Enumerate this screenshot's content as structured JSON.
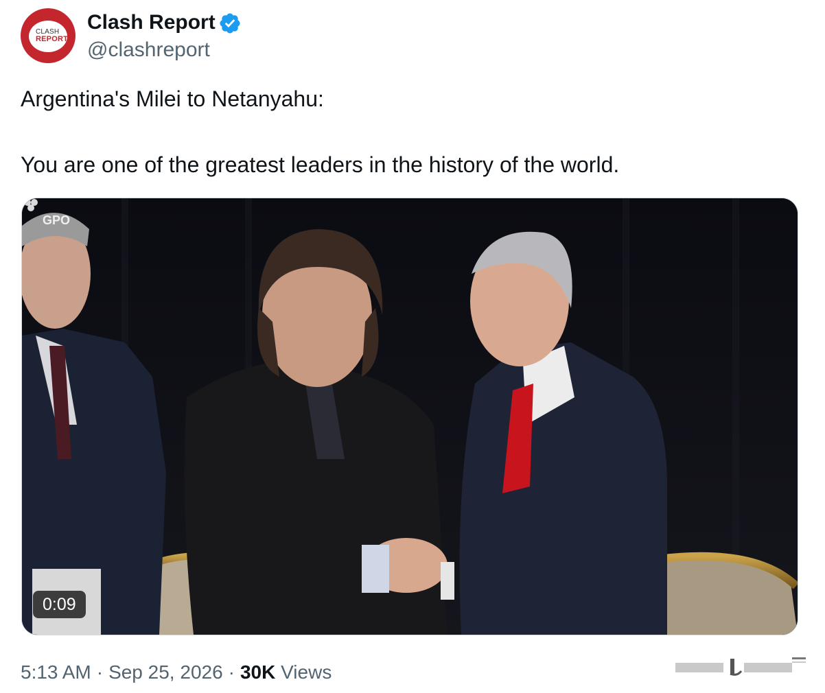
{
  "account": {
    "display_name": "Clash Report",
    "handle": "@clashreport",
    "verified": true,
    "avatar": {
      "line1": "CLASH",
      "line2": "REPORT",
      "color": "#c4262e"
    }
  },
  "tweet": {
    "lines": [
      "Argentina's Milei to Netanyahu:",
      "You are one of the greatest leaders in the history of the world."
    ]
  },
  "media": {
    "type": "video",
    "icon": "video-thumbnail",
    "watermark": "GPO",
    "duration": "0:09"
  },
  "meta": {
    "time": "5:13 AM",
    "date": "Sep 25, 2026",
    "separator": "·",
    "views_count": "30K",
    "views_label": "Views"
  },
  "colors": {
    "text_primary": "#0f1419",
    "text_secondary": "#536471",
    "verified_blue": "#1d9bf0",
    "brand_red": "#c4262e"
  }
}
